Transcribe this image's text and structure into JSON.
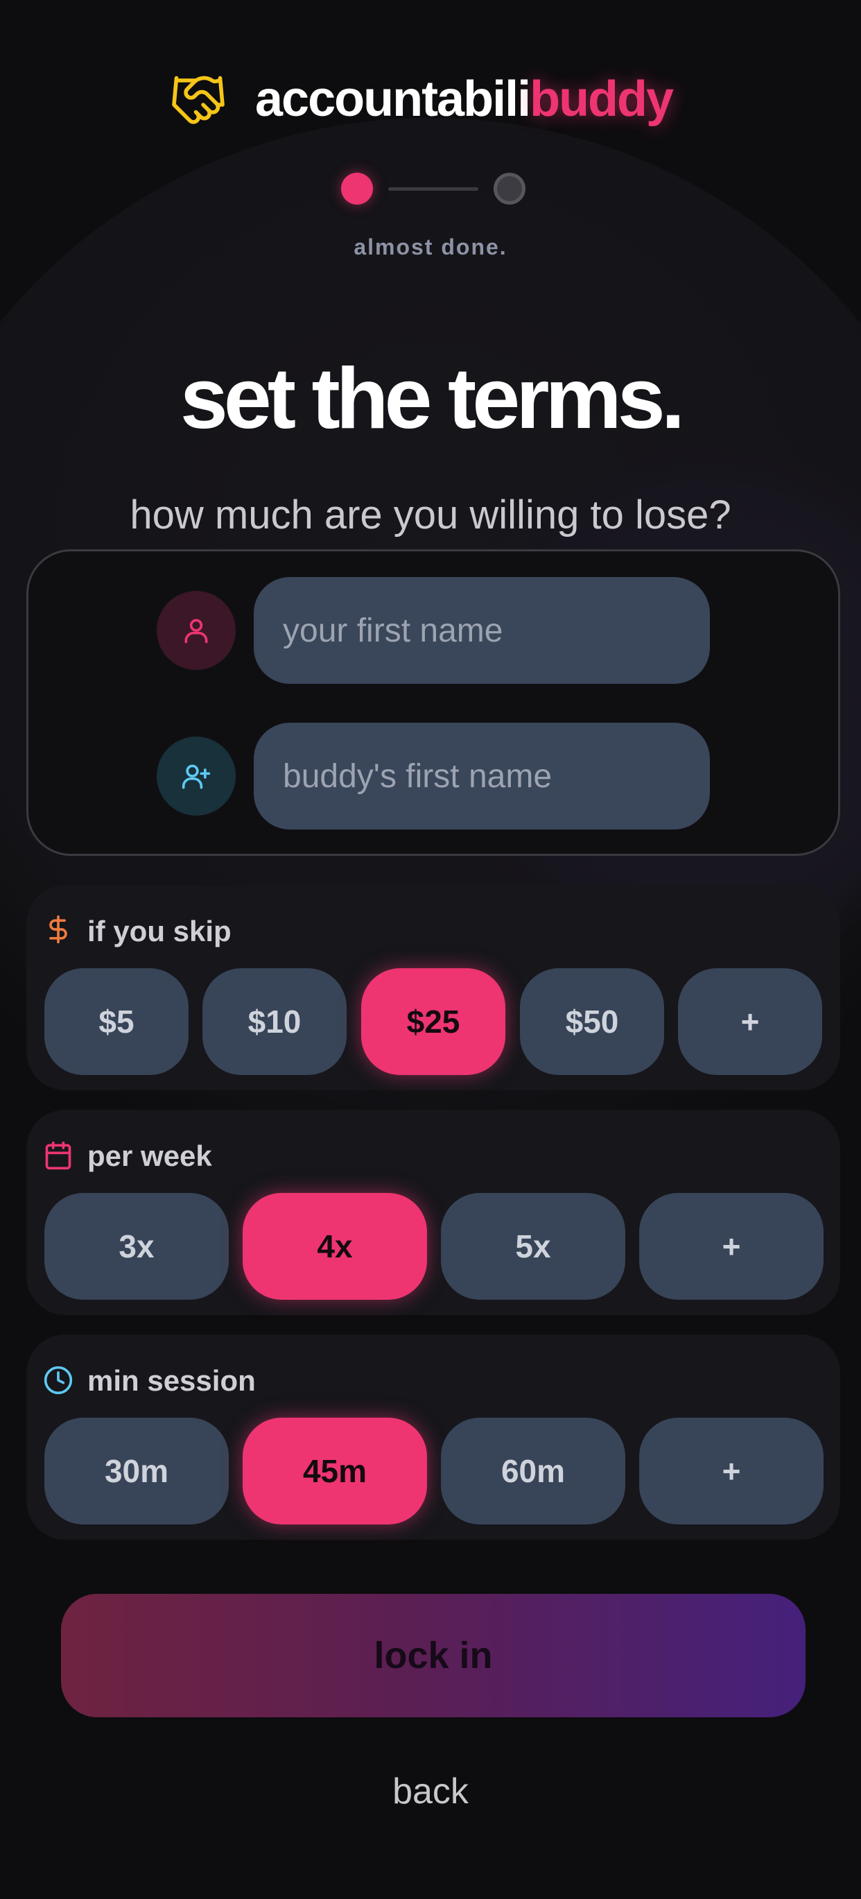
{
  "brand": {
    "part1": "accountabili",
    "part2": "buddy"
  },
  "progress": {
    "step": 1,
    "total": 2,
    "label": "almost done."
  },
  "title": "set the terms.",
  "subtitle": "how much are you willing to lose?",
  "names": {
    "my_name_placeholder": "your first name",
    "buddy_name_placeholder": "buddy's first name"
  },
  "skip": {
    "label": "if you skip",
    "options": [
      "$5",
      "$10",
      "$25",
      "$50",
      "+"
    ],
    "selected": "$25"
  },
  "per_week": {
    "label": "per week",
    "options": [
      "3x",
      "4x",
      "5x",
      "+"
    ],
    "selected": "4x"
  },
  "min_session": {
    "label": "min session",
    "options": [
      "30m",
      "45m",
      "60m",
      "+"
    ],
    "selected": "45m"
  },
  "actions": {
    "lock_in": "lock in",
    "back": "back"
  },
  "colors": {
    "accent": "#ee3571",
    "background": "#0d0d0f",
    "handshake_icon": "#f5c518",
    "dollar_icon": "#f07b3f",
    "calendar_icon": "#ee3571",
    "clock_icon": "#5ec9f2",
    "user_icon": "#ee3571",
    "user_plus_icon": "#5ec9f2"
  },
  "icons": [
    "handshake-icon",
    "user-icon",
    "user-plus-icon",
    "dollar-icon",
    "calendar-icon",
    "clock-icon"
  ]
}
